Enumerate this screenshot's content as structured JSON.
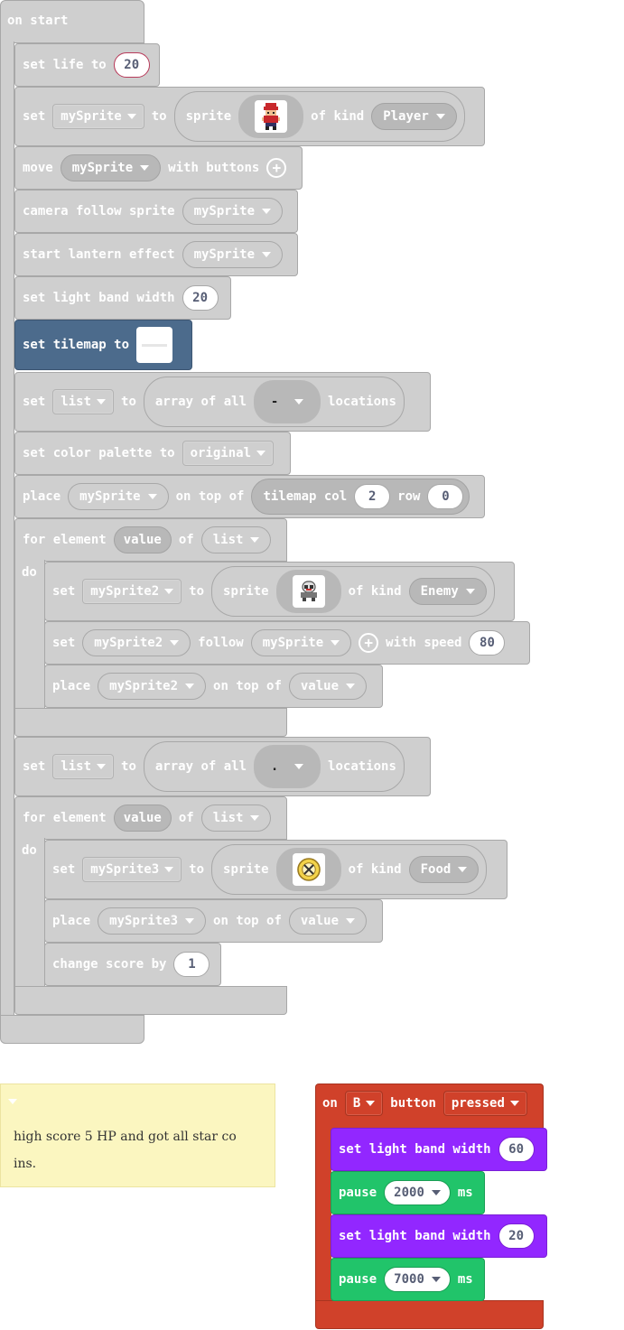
{
  "on_start": {
    "hat_label": "on start",
    "set_life": {
      "label": "set life to",
      "value": "20"
    },
    "set_sprite": {
      "set": "set",
      "var": "mySprite",
      "to": "to",
      "sprite": "sprite",
      "of_kind": "of kind",
      "kind": "Player"
    },
    "move": {
      "label": "move",
      "var": "mySprite",
      "with_buttons": "with buttons"
    },
    "camera": {
      "label": "camera follow sprite",
      "var": "mySprite"
    },
    "lantern": {
      "label": "start lantern effect",
      "var": "mySprite"
    },
    "light1": {
      "label": "set light band width",
      "value": "20"
    },
    "tilemap": {
      "label": "set tilemap to"
    },
    "list1": {
      "set": "set",
      "var": "list",
      "to": "to",
      "array": "array of all",
      "tile": "-",
      "locations": "locations"
    },
    "palette": {
      "label": "set color palette to",
      "value": "original"
    },
    "place1": {
      "label": "place",
      "var": "mySprite",
      "on_top": "on top of",
      "tilemap_col": "tilemap col",
      "col": "2",
      "row_label": "row",
      "row": "0"
    },
    "for1": {
      "for": "for element",
      "var": "value",
      "of": "of",
      "list": "list",
      "do": "do",
      "set_sprite2": {
        "set": "set",
        "var": "mySprite2",
        "to": "to",
        "sprite": "sprite",
        "of_kind": "of kind",
        "kind": "Enemy"
      },
      "follow": {
        "set": "set",
        "var": "mySprite2",
        "follow": "follow",
        "target": "mySprite",
        "with_speed": "with speed",
        "speed": "80"
      },
      "place2": {
        "label": "place",
        "var": "mySprite2",
        "on_top": "on top of",
        "value": "value"
      }
    },
    "list2": {
      "set": "set",
      "var": "list",
      "to": "to",
      "array": "array of all",
      "tile": ".",
      "locations": "locations"
    },
    "for2": {
      "for": "for element",
      "var": "value",
      "of": "of",
      "list": "list",
      "do": "do",
      "set_sprite3": {
        "set": "set",
        "var": "mySprite3",
        "to": "to",
        "sprite": "sprite",
        "of_kind": "of kind",
        "kind": "Food"
      },
      "place3": {
        "label": "place",
        "var": "mySprite3",
        "on_top": "on top of",
        "value": "value"
      },
      "score": {
        "label": "change score by",
        "value": "1"
      }
    }
  },
  "comment": {
    "text_line1": "high score 5 HP and got all star co",
    "text_line2": "ins."
  },
  "on_button": {
    "on": "on",
    "button_name": "B",
    "button": "button",
    "event": "pressed",
    "light_a": {
      "label": "set light band width",
      "value": "60"
    },
    "pause_a": {
      "label": "pause",
      "value": "2000",
      "unit": "ms"
    },
    "light_b": {
      "label": "set light band width",
      "value": "20"
    },
    "pause_b": {
      "label": "pause",
      "value": "7000",
      "unit": "ms"
    }
  },
  "colors": {
    "grey_block": "#cfcfcf",
    "event_red": "#d0412a",
    "purple": "#9227ff",
    "green": "#21c46a",
    "tilemap_blue": "#4c6b8c",
    "comment_yellow": "#fbf6c0"
  }
}
